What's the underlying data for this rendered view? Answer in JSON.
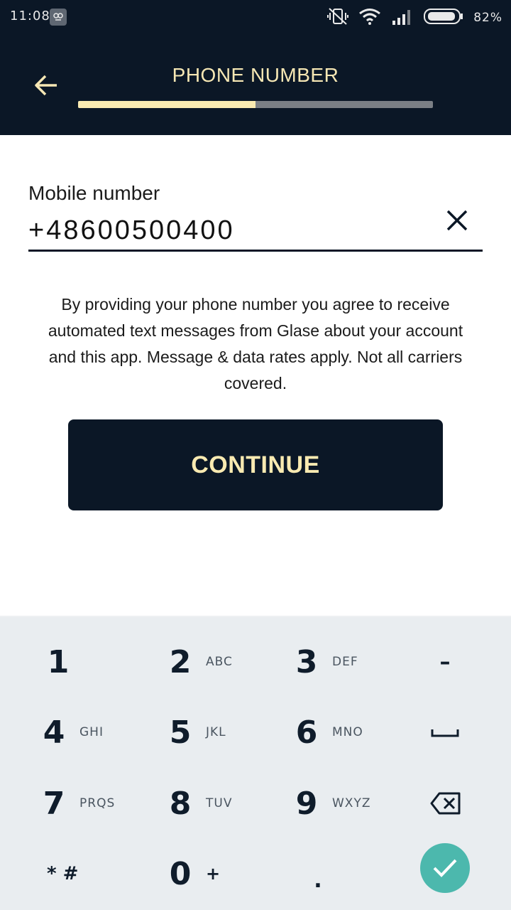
{
  "status_bar": {
    "time": "11:08",
    "battery_percent": "82%",
    "icons": [
      "app-notification-icon",
      "vibrate-off-icon",
      "wifi-icon",
      "signal-icon",
      "battery-icon"
    ]
  },
  "header": {
    "title": "PHONE NUMBER",
    "progress": 0.5,
    "colors": {
      "background": "#0b1726",
      "accent": "#f9eab1",
      "track": "#7b7f85"
    }
  },
  "form": {
    "field_label": "Mobile number",
    "phone_value": "+48600500400",
    "disclaimer": "By providing your phone number you agree to receive automated text messages from Glase about your account and this app. Message & data rates apply. Not all carriers covered.",
    "continue_label": "CONTINUE"
  },
  "keyboard": {
    "keys": {
      "k1": {
        "digit": "1",
        "letters": ""
      },
      "k2": {
        "digit": "2",
        "letters": "ABC"
      },
      "k3": {
        "digit": "3",
        "letters": "DEF"
      },
      "k4": {
        "digit": "4",
        "letters": "GHI"
      },
      "k5": {
        "digit": "5",
        "letters": "JKL"
      },
      "k6": {
        "digit": "6",
        "letters": "MNO"
      },
      "k7": {
        "digit": "7",
        "letters": "PRQS"
      },
      "k8": {
        "digit": "8",
        "letters": "TUV"
      },
      "k9": {
        "digit": "9",
        "letters": "WXYZ"
      },
      "k0": {
        "digit": "0",
        "letters": "+"
      }
    },
    "symbols": {
      "star_hash": "* #",
      "dash": "–",
      "dot": "."
    },
    "accent": "#4cb8ad"
  }
}
